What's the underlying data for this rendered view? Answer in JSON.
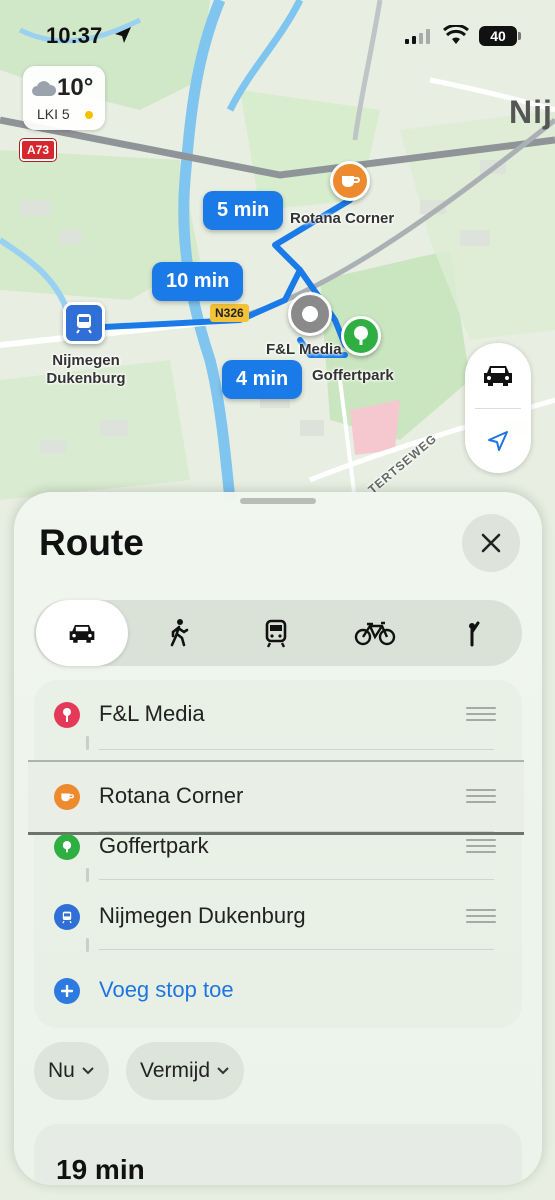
{
  "status_bar": {
    "time": "10:37",
    "battery": "40"
  },
  "weather": {
    "temperature": "10°",
    "air_quality": "LKI 5"
  },
  "map": {
    "city_label": "Nij",
    "road_shield_a": "A73",
    "road_shield_n": "N326",
    "street_label": "TERTSEWEG",
    "eta_labels": [
      "5 min",
      "10 min",
      "4 min"
    ],
    "places": {
      "rotana": "Rotana Corner",
      "fl_media": "F&L Media",
      "goffertpark": "Goffertpark",
      "station_line1": "Nijmegen",
      "station_line2": "Dukenburg"
    }
  },
  "sheet": {
    "title": "Route",
    "stops": [
      {
        "label": "F&L Media",
        "color": "#e5395a",
        "icon": "pin-icon"
      },
      {
        "label": "Rotana Corner",
        "color": "#ee8a2e",
        "icon": "cup-icon"
      },
      {
        "label": "Goffertpark",
        "color": "#2fae42",
        "icon": "tree-icon"
      },
      {
        "label": "Nijmegen Dukenburg",
        "color": "#2f6fd6",
        "icon": "train-icon"
      }
    ],
    "add_stop": "Voeg stop toe",
    "chip_now": "Nu",
    "chip_avoid": "Vermijd",
    "duration": "19 min"
  },
  "colors": {
    "route": "#1a7be8",
    "accent": "#1f75df"
  }
}
